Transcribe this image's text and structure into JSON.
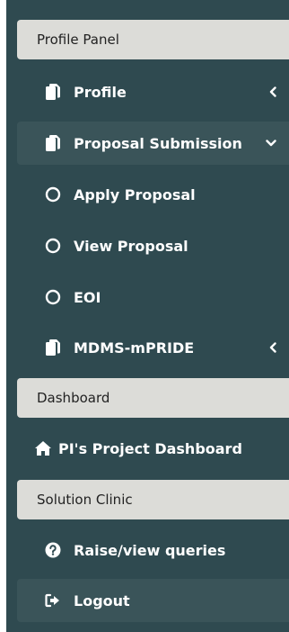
{
  "sidebar": {
    "profile_panel_header": "Profile Panel",
    "profile": "Profile",
    "proposal_submission": "Proposal Submission",
    "apply_proposal": "Apply Proposal",
    "view_proposal": "View Proposal",
    "eoi": "EOI",
    "mdms_mpride": "MDMS-mPRIDE",
    "dashboard_header": "Dashboard",
    "pi_project_dashboard": "PI's Project Dashboard",
    "solution_clinic_header": "Solution Clinic",
    "raise_view_queries": "Raise/view queries",
    "logout": "Logout"
  },
  "colors": {
    "sidebar_bg": "#2f4a50",
    "header_bg": "#dcdcd8",
    "active_bg": "#3a5459",
    "text": "#ffffff"
  },
  "icons": {
    "profile": "copy-icon",
    "proposal_submission": "copy-icon",
    "apply_proposal": "circle-outline-icon",
    "view_proposal": "circle-outline-icon",
    "eoi": "circle-outline-icon",
    "mdms_mpride": "copy-icon",
    "pi_project_dashboard": "home-icon",
    "raise_view_queries": "question-circle-icon",
    "logout": "sign-out-icon"
  }
}
